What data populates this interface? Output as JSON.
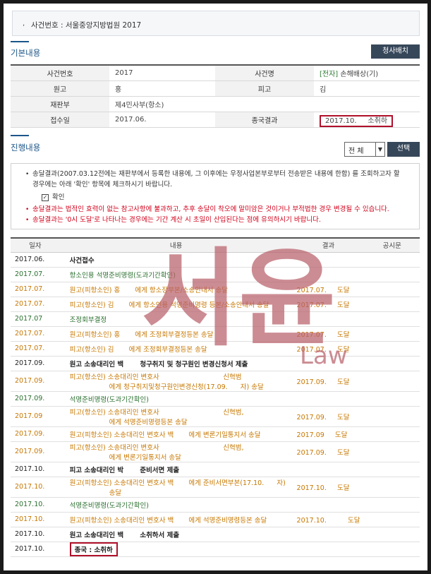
{
  "case_bar": {
    "label": "사건번호 : 서울중앙지방법원 2017"
  },
  "basic": {
    "title": "기본내용",
    "print_button": "청사배치",
    "rows": [
      {
        "k1": "사건번호",
        "v1": "2017",
        "k2": "사건명",
        "v2_tag": "[전자]",
        "v2": "손해배상(기)"
      },
      {
        "k1": "원고",
        "v1": "홍",
        "k2": "피고",
        "v2": "김"
      },
      {
        "k1": "재판부",
        "v1": "제4민사부(항소)",
        "k2": "",
        "v2": ""
      },
      {
        "k1": "접수일",
        "v1": "2017.06.",
        "k2": "종국결과",
        "v2": "2017.10.     소취하"
      }
    ]
  },
  "progress": {
    "title": "진행내용",
    "filter_value": "전 체",
    "select_button": "선택",
    "notice": {
      "line1": "송달결과(2007.03.12전에는 재판부에서 등록한 내용에, 그 이후에는 우정사업본부로부터 전송받은 내용에 한함) 를 조회하고자 할",
      "line2": "경우에는 아래 '확인' 항목에 체크하시기 바랍니다.",
      "check_label": "확인",
      "warn1": "송달결과는 법적인 효력이 없는 참고사항에 불과하고, 추후 송달이 착오에 말미암은 것이거나 부적법한 경우 변경될 수 있습니다.",
      "warn2": "송달결과는 '0시 도달'로 나타나는 경우에는 기간 계산 시 초일이 산입된다는 점에 유의하시기 바랍니다."
    },
    "headers": [
      "일자",
      "내용",
      "결과",
      "공시문"
    ],
    "rows": [
      {
        "date": "2017.06.",
        "content": "사건접수",
        "result": "",
        "color": "dark"
      },
      {
        "date": "2017.07.",
        "content": "항소인용 석명준비명령(도과기간확인)",
        "result": "",
        "color": "green"
      },
      {
        "date": "2017.07.",
        "content": "원고(피항소인) 홍       에게 항소장부본/소송안내서 송달",
        "result": "2017.07.     도달",
        "color": "orange"
      },
      {
        "date": "2017.07.",
        "content": "피고(항소인) 김       에게 항소인용 석명준비명령 등본/소송안내서 송달",
        "result": "2017.07.     도달",
        "color": "orange"
      },
      {
        "date": "2017.07",
        "content": "조정회부결정",
        "result": "",
        "color": "green"
      },
      {
        "date": "2017.07.",
        "content": "원고(피항소인) 홍       에게 조정회부결정등본 송달",
        "result": "2017.07.     도달",
        "color": "orange"
      },
      {
        "date": "2017.07.",
        "content": "피고(항소인) 김       에게 조정회부결정등본 송달",
        "result": "2017.07.     도달",
        "color": "orange"
      },
      {
        "date": "2017.09.",
        "content": "원고 소송대리인 백       청구취지 및 청구원인 변경신청서 제출",
        "result": "",
        "color": "dark"
      },
      {
        "date": "2017.09.",
        "content": "피고(항소인) 소송대리인 변호사                              신혁범",
        "content2": "에게 청구취지및청구원인변경신청(17.09.      자) 송달",
        "result": "2017.09.     도달",
        "color": "orange"
      },
      {
        "date": "2017.09.",
        "content": "석명준비명령(도과기간확인)",
        "result": "",
        "color": "green"
      },
      {
        "date": "2017.09",
        "content": "피고(항소인) 소송대리인 변호사                              신혁범,",
        "content2": "에게 석명준비명령등본 송달",
        "result": "2017.09.     도달",
        "color": "orange"
      },
      {
        "date": "2017.09.",
        "content": "원고(피항소인) 소송대리인 변호사 백       에게 변론기일통지서 송달",
        "result": "2017.09     도달",
        "color": "orange"
      },
      {
        "date": "2017.09.",
        "content": "피고(항소인) 소송대리인 변호사                              신혁범,",
        "content2": "에게 변론기일통지서 송달",
        "result": "2017.09.     도달",
        "color": "orange"
      },
      {
        "date": "2017.10.",
        "content": "피고 소송대리인 박       준비서면 제출",
        "result": "",
        "color": "dark"
      },
      {
        "date": "2017.10.",
        "content": "원고(피항소인) 소송대리인 변호사 백       에게 준비서면부본(17.10.      자)",
        "content2": "송달",
        "result": "2017.10.     도달",
        "color": "orange"
      },
      {
        "date": "2017.10.",
        "content": "석명준비명령(도과기간확인)",
        "result": "",
        "color": "green"
      },
      {
        "date": "2017.10.",
        "content": "원고(피항소인) 소송대리인 변호사 백       에게 석명준비명령등본 송달",
        "result": "2017.10.          도달",
        "color": "orange"
      },
      {
        "date": "2017.10.",
        "content": "원고 소송대리인 백       소취하서 제출",
        "result": "",
        "color": "dark"
      },
      {
        "date": "2017.10.",
        "content": "종국 : 소취하",
        "result": "",
        "color": "dark",
        "boxed": true
      }
    ]
  },
  "watermark": {
    "text": "서윤",
    "sub": "Law",
    "color": "#b8606a"
  }
}
